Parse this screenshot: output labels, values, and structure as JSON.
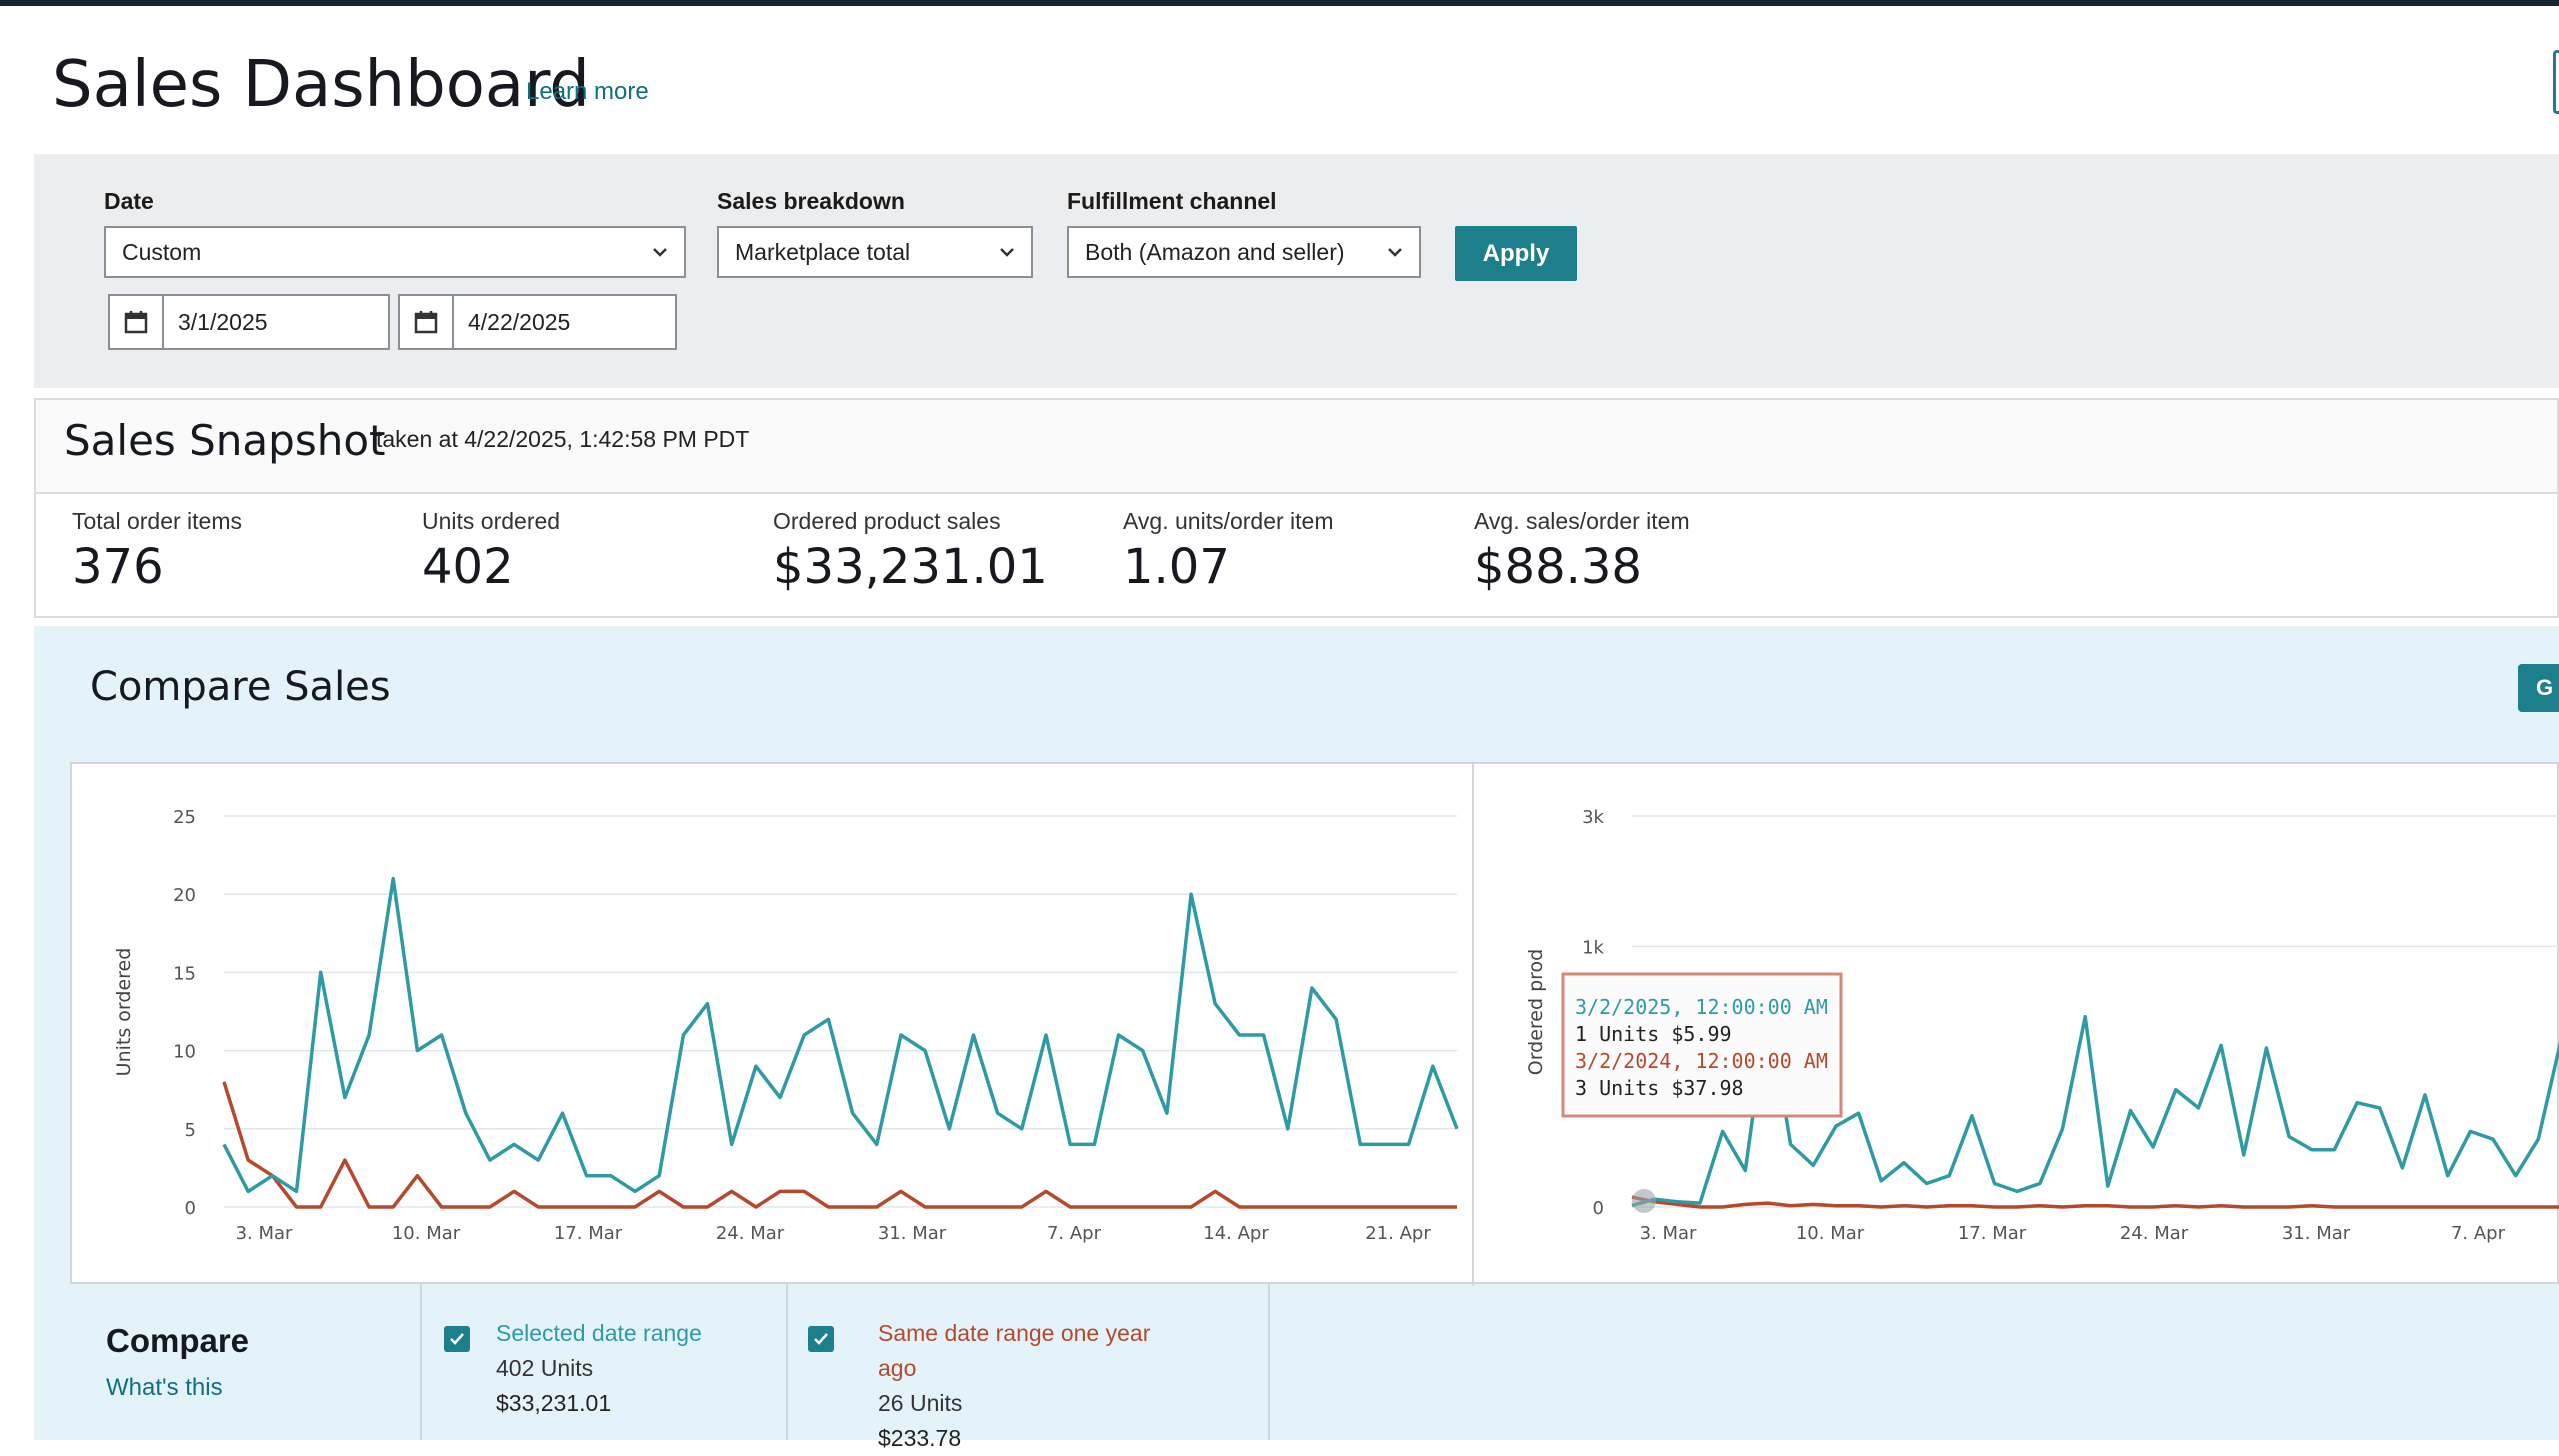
{
  "header": {
    "title": "Sales Dashboard",
    "learn_more": "Learn more"
  },
  "filters": {
    "date_label": "Date",
    "date_value": "Custom",
    "start_date": "3/1/2025",
    "end_date": "4/22/2025",
    "breakdown_label": "Sales breakdown",
    "breakdown_value": "Marketplace total",
    "channel_label": "Fulfillment channel",
    "channel_value": "Both (Amazon and seller)",
    "apply": "Apply"
  },
  "snapshot": {
    "title": "Sales Snapshot",
    "taken_at": "taken at 4/22/2025, 1:42:58 PM PDT",
    "metrics": [
      {
        "label": "Total order items",
        "value": "376"
      },
      {
        "label": "Units ordered",
        "value": "402"
      },
      {
        "label": "Ordered product sales",
        "value": "$33,231.01"
      },
      {
        "label": "Avg. units/order item",
        "value": "1.07"
      },
      {
        "label": "Avg. sales/order item",
        "value": "$88.38"
      }
    ]
  },
  "compare_sales": {
    "title": "Compare Sales",
    "right_button_fragment": "G",
    "tooltip": {
      "line1": "3/2/2025, 12:00:00 AM",
      "line2": "1 Units $5.99",
      "line3": "3/2/2024, 12:00:00 AM",
      "line4": "3 Units $37.98"
    }
  },
  "compare_legend": {
    "label": "Compare",
    "whats_this": "What's this",
    "selected": {
      "title": "Selected date range",
      "units": "402 Units",
      "sales": "$33,231.01"
    },
    "prior": {
      "title_line1": "Same date range one year",
      "title_line2": "ago",
      "units": "26 Units",
      "sales": "$233.78"
    }
  },
  "colors": {
    "current": "#2e9aa4",
    "prior": "#b5492c",
    "accent": "#1e7f8c",
    "link": "#0f6f82"
  },
  "chart_data": [
    {
      "type": "line",
      "ylabel": "Units ordered",
      "ylim": [
        0,
        25
      ],
      "yticks": [
        0,
        5,
        10,
        15,
        20,
        25
      ],
      "xticks": [
        "3. Mar",
        "10. Mar",
        "17. Mar",
        "24. Mar",
        "31. Mar",
        "7. Apr",
        "14. Apr",
        "21. Apr"
      ],
      "x_start_day": 0,
      "grid": true,
      "series": [
        {
          "name": "Selected date range",
          "values": [
            4,
            1,
            2,
            1,
            15,
            7,
            11,
            21,
            10,
            11,
            6,
            3,
            4,
            3,
            6,
            2,
            2,
            1,
            2,
            11,
            13,
            4,
            9,
            7,
            11,
            12,
            6,
            4,
            11,
            10,
            5,
            11,
            6,
            5,
            11,
            4,
            4,
            11,
            10,
            6,
            20,
            13,
            11,
            11,
            5,
            14,
            12,
            4,
            4,
            4,
            9,
            5
          ]
        },
        {
          "name": "Same date range one year ago",
          "values": [
            8,
            3,
            2,
            0,
            0,
            3,
            0,
            0,
            2,
            0,
            0,
            0,
            1,
            0,
            0,
            0,
            0,
            0,
            1,
            0,
            0,
            1,
            0,
            1,
            1,
            0,
            0,
            0,
            1,
            0,
            0,
            0,
            0,
            0,
            1,
            0,
            0,
            0,
            0,
            0,
            0,
            1,
            0,
            0,
            0,
            0,
            0,
            0,
            0,
            0,
            0,
            0
          ]
        }
      ]
    },
    {
      "type": "line",
      "ylabel": "Ordered prod",
      "yticks_labels": [
        "0",
        "1k",
        "3k"
      ],
      "ytick_values": [
        0,
        1000,
        1500
      ],
      "ylim": [
        0,
        1500
      ],
      "xticks": [
        "3. Mar",
        "10. Mar",
        "17. Mar",
        "24. Mar",
        "31. Mar",
        "7. Apr"
      ],
      "grid": true,
      "series": [
        {
          "name": "Selected date range",
          "values": [
            6,
            30,
            20,
            15,
            290,
            140,
            770,
            240,
            160,
            310,
            360,
            100,
            170,
            90,
            120,
            350,
            90,
            60,
            90,
            300,
            730,
            80,
            370,
            230,
            450,
            380,
            620,
            200,
            610,
            270,
            220,
            220,
            400,
            380,
            150,
            430,
            120,
            290,
            260,
            120,
            260,
            640
          ]
        },
        {
          "name": "Same date range one year ago",
          "values": [
            38,
            20,
            10,
            0,
            0,
            10,
            15,
            5,
            10,
            5,
            5,
            0,
            5,
            0,
            5,
            5,
            0,
            0,
            5,
            0,
            5,
            5,
            0,
            0,
            5,
            0,
            5,
            0,
            0,
            0,
            5,
            0,
            0,
            0,
            0,
            0,
            0,
            0,
            0,
            0,
            0,
            0
          ]
        }
      ]
    }
  ]
}
